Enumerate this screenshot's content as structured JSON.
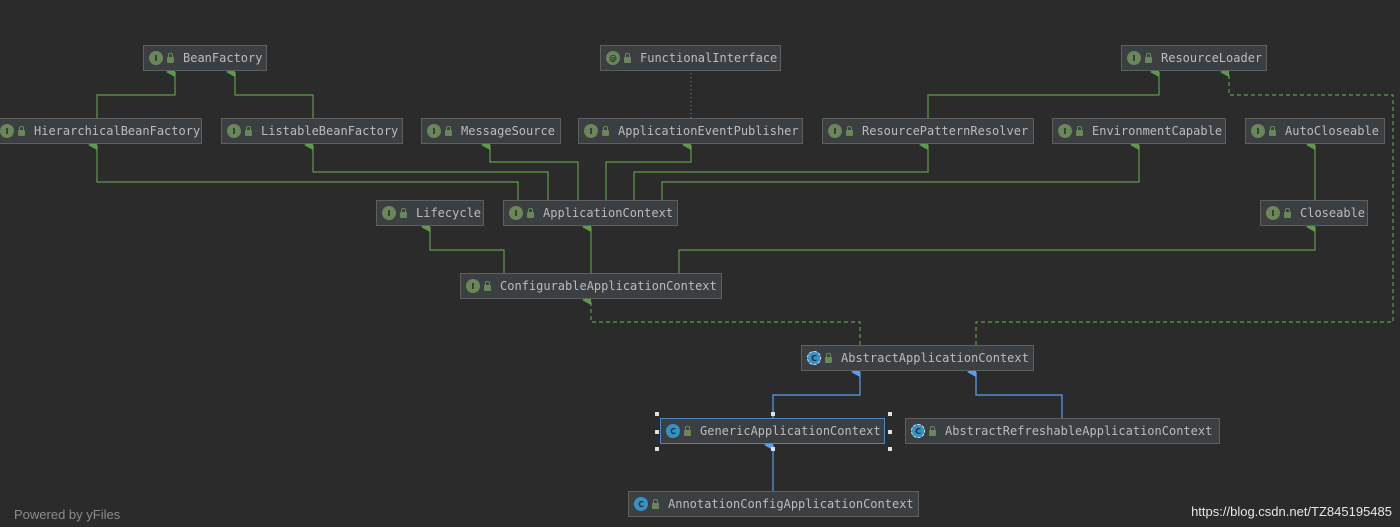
{
  "diagram": {
    "nodes": [
      {
        "id": "BeanFactory",
        "label": "BeanFactory",
        "kind": "interface"
      },
      {
        "id": "FunctionalInterface",
        "label": "FunctionalInterface",
        "kind": "annotation"
      },
      {
        "id": "ResourceLoader",
        "label": "ResourceLoader",
        "kind": "interface"
      },
      {
        "id": "HierarchicalBeanFactory",
        "label": "HierarchicalBeanFactory",
        "kind": "interface"
      },
      {
        "id": "ListableBeanFactory",
        "label": "ListableBeanFactory",
        "kind": "interface"
      },
      {
        "id": "MessageSource",
        "label": "MessageSource",
        "kind": "interface"
      },
      {
        "id": "ApplicationEventPublisher",
        "label": "ApplicationEventPublisher",
        "kind": "interface"
      },
      {
        "id": "ResourcePatternResolver",
        "label": "ResourcePatternResolver",
        "kind": "interface"
      },
      {
        "id": "EnvironmentCapable",
        "label": "EnvironmentCapable",
        "kind": "interface"
      },
      {
        "id": "AutoCloseable",
        "label": "AutoCloseable",
        "kind": "interface"
      },
      {
        "id": "Lifecycle",
        "label": "Lifecycle",
        "kind": "interface"
      },
      {
        "id": "ApplicationContext",
        "label": "ApplicationContext",
        "kind": "interface"
      },
      {
        "id": "Closeable",
        "label": "Closeable",
        "kind": "interface"
      },
      {
        "id": "ConfigurableApplicationContext",
        "label": "ConfigurableApplicationContext",
        "kind": "interface"
      },
      {
        "id": "AbstractApplicationContext",
        "label": "AbstractApplicationContext",
        "kind": "abstract"
      },
      {
        "id": "GenericApplicationContext",
        "label": "GenericApplicationContext",
        "kind": "class",
        "selected": true
      },
      {
        "id": "AbstractRefreshableApplicationContext",
        "label": "AbstractRefreshableApplicationContext",
        "kind": "abstract"
      },
      {
        "id": "AnnotationConfigApplicationContext",
        "label": "AnnotationConfigApplicationContext",
        "kind": "class"
      }
    ],
    "edges": [
      {
        "from": "HierarchicalBeanFactory",
        "to": "BeanFactory",
        "type": "extends"
      },
      {
        "from": "ListableBeanFactory",
        "to": "BeanFactory",
        "type": "extends"
      },
      {
        "from": "ResourcePatternResolver",
        "to": "ResourceLoader",
        "type": "extends"
      },
      {
        "from": "ApplicationEventPublisher",
        "to": "FunctionalInterface",
        "type": "annotated"
      },
      {
        "from": "ApplicationContext",
        "to": "HierarchicalBeanFactory",
        "type": "extends"
      },
      {
        "from": "ApplicationContext",
        "to": "ListableBeanFactory",
        "type": "extends"
      },
      {
        "from": "ApplicationContext",
        "to": "MessageSource",
        "type": "extends"
      },
      {
        "from": "ApplicationContext",
        "to": "ApplicationEventPublisher",
        "type": "extends"
      },
      {
        "from": "ApplicationContext",
        "to": "ResourcePatternResolver",
        "type": "extends"
      },
      {
        "from": "ApplicationContext",
        "to": "EnvironmentCapable",
        "type": "extends"
      },
      {
        "from": "Closeable",
        "to": "AutoCloseable",
        "type": "extends"
      },
      {
        "from": "ConfigurableApplicationContext",
        "to": "Lifecycle",
        "type": "extends"
      },
      {
        "from": "ConfigurableApplicationContext",
        "to": "ApplicationContext",
        "type": "extends"
      },
      {
        "from": "ConfigurableApplicationContext",
        "to": "Closeable",
        "type": "extends"
      },
      {
        "from": "AbstractApplicationContext",
        "to": "ConfigurableApplicationContext",
        "type": "implements"
      },
      {
        "from": "AbstractApplicationContext",
        "to": "ResourceLoader",
        "type": "implements"
      },
      {
        "from": "GenericApplicationContext",
        "to": "AbstractApplicationContext",
        "type": "class-extends"
      },
      {
        "from": "AbstractRefreshableApplicationContext",
        "to": "AbstractApplicationContext",
        "type": "class-extends"
      },
      {
        "from": "AnnotationConfigApplicationContext",
        "to": "GenericApplicationContext",
        "type": "class-extends"
      }
    ]
  },
  "colors": {
    "background": "#2b2b2b",
    "interface_edge": "#5f9b4b",
    "class_edge": "#589df6",
    "annotation_edge": "#6a8759",
    "node_fill": "#3c3f41",
    "node_border": "#5e6060",
    "selected_border": "#4a88c7"
  },
  "icons": {
    "interface": "interface-icon",
    "annotation": "annotation-icon",
    "class": "class-icon",
    "abstract": "abstract-class-icon"
  },
  "footer": {
    "powered_by": "Powered by yFiles",
    "watermark": "https://blog.csdn.net/TZ845195485"
  }
}
